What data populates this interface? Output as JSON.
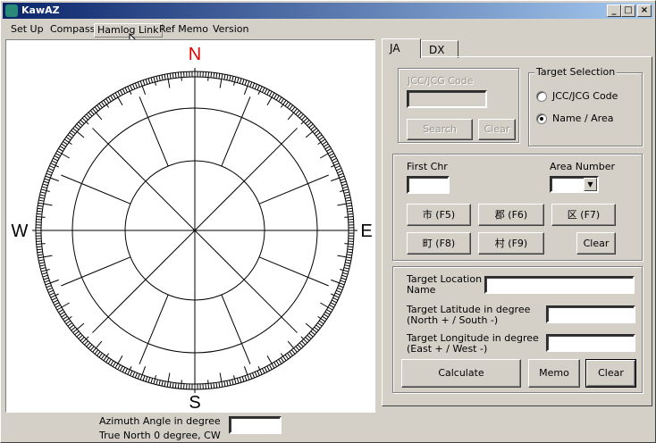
{
  "window": {
    "title": "KawAZ",
    "minimize": "_",
    "maximize": "□",
    "close": "×"
  },
  "menu": [
    "Set Up",
    "Compass",
    "Hamlog Link",
    "Ref Memo",
    "Version"
  ],
  "compass": {
    "north": "N",
    "south": "S",
    "east": "E",
    "west": "W",
    "north_color": "#e00000"
  },
  "azimuth": {
    "line1": "Azimuth Angle in degree",
    "line2": "True North 0 degree, CW",
    "value": ""
  },
  "tabs": [
    "JA",
    "DX"
  ],
  "code_group": {
    "legend": "JCC/JCG Code",
    "value": "",
    "search": "Search",
    "clear": "Clear"
  },
  "target_selection": {
    "legend": "Target Selection",
    "opt1": "JCC/JCG Code",
    "opt2": "Name / Area",
    "selected": "Name / Area"
  },
  "name_group": {
    "first_chr_label": "First Chr",
    "first_chr_value": "",
    "area_label": "Area Number",
    "area_value": "",
    "btn_shi": "市 (F5)",
    "btn_gun": "郡 (F6)",
    "btn_ku": "区 (F7)",
    "btn_machi": "町 (F8)",
    "btn_mura": "村 (F9)",
    "clear": "Clear"
  },
  "location_group": {
    "name_label_1": "Target Location",
    "name_label_2": "Name",
    "name_value": "",
    "lat_label_1": "Target Latitude in degree",
    "lat_label_2": "(North + / South -)",
    "lat_value": "",
    "lon_label_1": "Target Longitude in degree",
    "lon_label_2": "(East + / West -)",
    "lon_value": "",
    "calculate": "Calculate",
    "memo": "Memo",
    "clear": "Clear"
  }
}
